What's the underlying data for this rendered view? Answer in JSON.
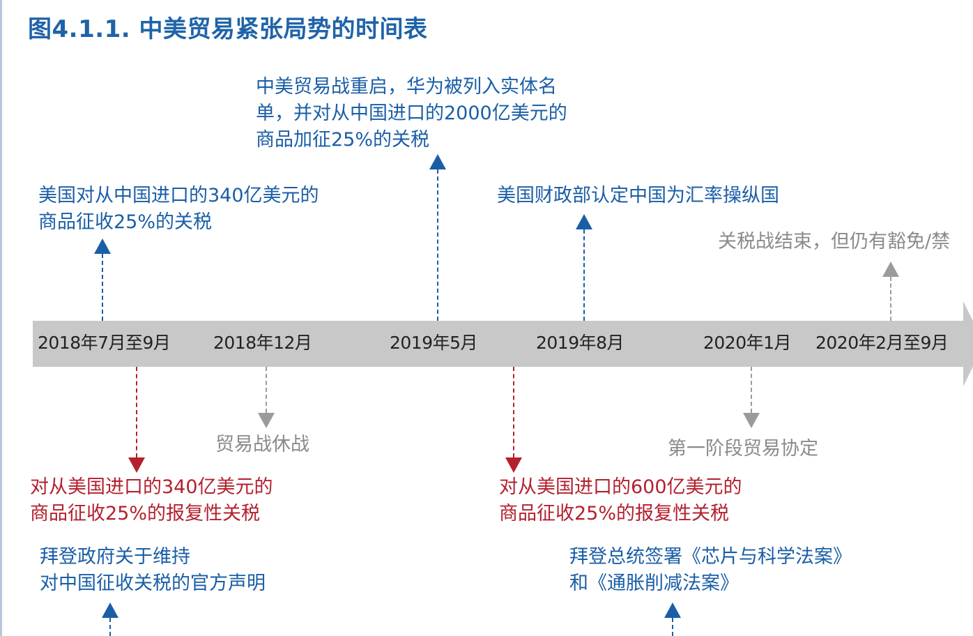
{
  "title": "图4.1.1. 中美贸易紧张局势的时间表",
  "colors": {
    "blue": "#1a5ea6",
    "red": "#b3202e",
    "gray": "#8a8a8a",
    "bar": "#c8c8c8"
  },
  "timeline": {
    "dates": [
      "2018年7月至9月",
      "2018年12月",
      "2019年5月",
      "2019年8月",
      "2020年1月",
      "2020年2月至9月"
    ]
  },
  "events": {
    "us_340": {
      "lines": [
        "美国对从中国进口的340亿美元的",
        "商品征收25%的关税"
      ]
    },
    "trade_war_restart": {
      "lines": [
        "中美贸易战重启，华为被列入实体名",
        "单，并对从中国进口的2000亿美元的",
        "商品加征25%的关税"
      ]
    },
    "currency_manipulator": {
      "lines": [
        "美国财政部认定中国为汇率操纵国"
      ]
    },
    "tariff_war_end": {
      "lines": [
        "关税战结束，但仍有豁免/禁"
      ]
    },
    "china_340": {
      "lines": [
        "对从美国进口的340亿美元的",
        "商品征收25%的报复性关税"
      ]
    },
    "truce": {
      "lines": [
        "贸易战休战"
      ]
    },
    "china_600": {
      "lines": [
        "对从美国进口的600亿美元的",
        "商品征收25%的报复性关税"
      ]
    },
    "phase_one": {
      "lines": [
        "第一阶段贸易协定"
      ]
    },
    "biden_tariffs": {
      "lines": [
        "拜登政府关于维持",
        "对中国征收关税的官方声明"
      ]
    },
    "chips_act": {
      "lines": [
        "拜登总统签署《芯片与科学法案》",
        "和《通胀削减法案》"
      ]
    }
  }
}
